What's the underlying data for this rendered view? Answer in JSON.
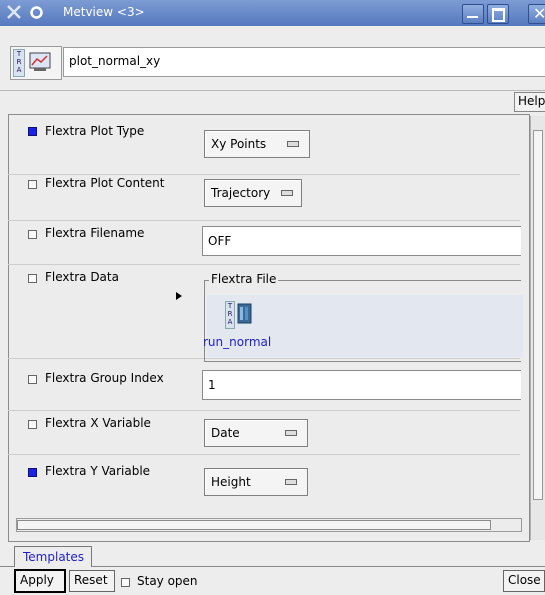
{
  "window": {
    "title": "Metview <3>"
  },
  "icon_name": {
    "value": "plot_normal_xy"
  },
  "help": {
    "label": "Help"
  },
  "params": [
    {
      "label": "Flextra Plot Type",
      "checked": true,
      "kind": "dropdown",
      "value": "Xy Points"
    },
    {
      "label": "Flextra Plot Content",
      "checked": false,
      "kind": "dropdown",
      "value": "Trajectory"
    },
    {
      "label": "Flextra Filename",
      "checked": false,
      "kind": "text",
      "value": "OFF"
    },
    {
      "label": "Flextra Data",
      "checked": false,
      "kind": "drop-area",
      "group_title": "Flextra File",
      "icon_label": "run_normal"
    },
    {
      "label": "Flextra Group Index",
      "checked": false,
      "kind": "text",
      "value": "1"
    },
    {
      "label": "Flextra X Variable",
      "checked": false,
      "kind": "dropdown",
      "value": "Date"
    },
    {
      "label": "Flextra Y Variable",
      "checked": true,
      "kind": "dropdown",
      "value": "Height"
    }
  ],
  "tabs": [
    "Templates"
  ],
  "bottom": {
    "apply": "Apply",
    "reset": "Reset",
    "stay_open": "Stay open",
    "close": "Close"
  },
  "colors": {
    "titlebar": "#5a7cc1",
    "checked": "#1b21e6",
    "link": "#1f1fc7"
  },
  "icons": [
    "metview-app-icon",
    "window-close-icon",
    "minimize-icon",
    "maximize-icon",
    "close-icon",
    "tra-icon",
    "plot-icon",
    "drop-arrow-icon",
    "data-file-icon"
  ]
}
